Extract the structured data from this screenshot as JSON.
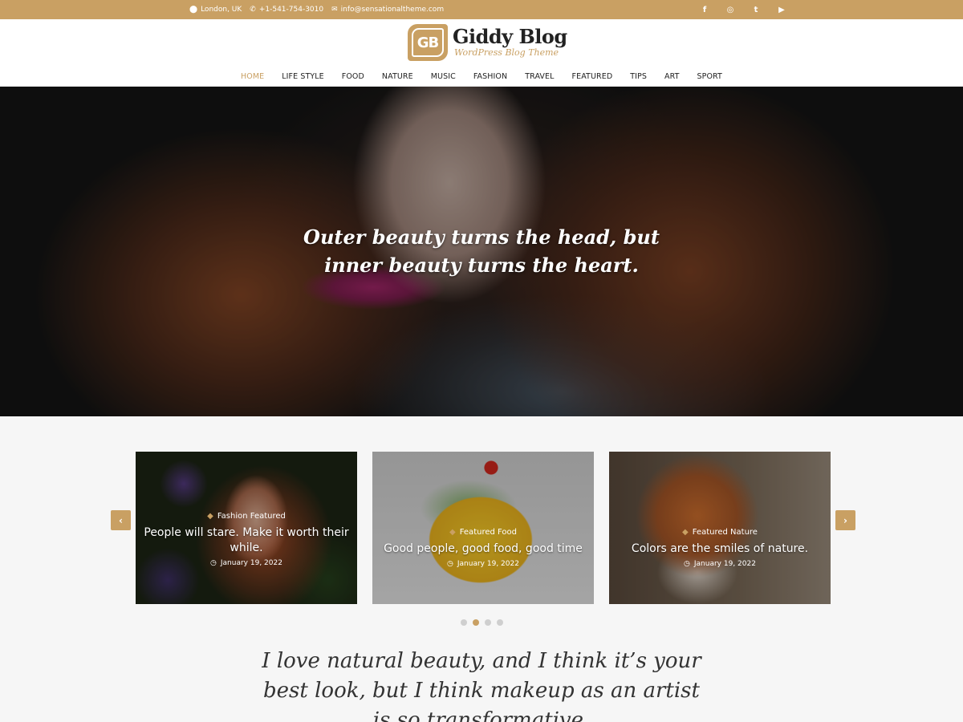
{
  "topbar": {
    "location": "London, UK",
    "phone": "+1-541-754-3010",
    "email": "info@sensationaltheme.com",
    "social": [
      "f",
      "◎",
      "t",
      "▶"
    ]
  },
  "logo": {
    "badge": "GB",
    "title": "Giddy Blog",
    "subtitle": "WordPress Blog Theme"
  },
  "nav": [
    "HOME",
    "LIFE STYLE",
    "FOOD",
    "NATURE",
    "MUSIC",
    "FASHION",
    "TRAVEL",
    "FEATURED",
    "TIPS",
    "ART",
    "SPORT"
  ],
  "hero": {
    "quote_line1": "Outer beauty turns the head, but",
    "quote_line2": "inner beauty turns the heart."
  },
  "carousel": {
    "cards": [
      {
        "categories": "Fashion Featured",
        "title": "People will stare. Make it worth their while.",
        "date": "January 19, 2022"
      },
      {
        "categories": "Featured Food",
        "title": "Good people, good food, good time",
        "date": "January 19, 2022"
      },
      {
        "categories": "Featured Nature",
        "title": "Colors are the smiles of nature.",
        "date": "January 19, 2022"
      }
    ],
    "prev": "‹",
    "next": "›",
    "active_dot": 1,
    "dot_count": 4
  },
  "bottom_quote": {
    "line1": "I love natural beauty, and I think it’s your",
    "line2": "best look, but I think makeup as an artist",
    "line3": "is so transformative."
  },
  "colors": {
    "accent": "#c9a063",
    "text": "#333333"
  }
}
